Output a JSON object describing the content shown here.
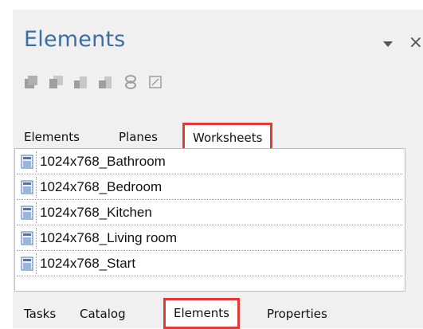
{
  "panel": {
    "title": "Elements"
  },
  "toolbar": {
    "buttons": [
      {
        "icon": "bring-to-front-icon"
      },
      {
        "icon": "send-to-back-icon"
      },
      {
        "icon": "bring-forward-icon"
      },
      {
        "icon": "send-backward-icon"
      },
      {
        "icon": "visibility-icon"
      },
      {
        "icon": "lock-icon"
      }
    ]
  },
  "top_tabs": [
    {
      "label": "Elements"
    },
    {
      "label": "Planes"
    },
    {
      "label": "Worksheets",
      "active": true
    }
  ],
  "worksheets": [
    {
      "label": "1024x768_Bathroom"
    },
    {
      "label": "1024x768_Bedroom"
    },
    {
      "label": "1024x768_Kitchen"
    },
    {
      "label": "1024x768_Living room"
    },
    {
      "label": "1024x768_Start"
    }
  ],
  "bottom_tabs": [
    {
      "label": "Tasks"
    },
    {
      "label": "Catalog"
    },
    {
      "label": "Elements",
      "active": true
    },
    {
      "label": "Properties"
    }
  ],
  "colors": {
    "title": "#3a6ea5",
    "highlight": "#e53935",
    "panel_bg": "#f0f0f0"
  }
}
